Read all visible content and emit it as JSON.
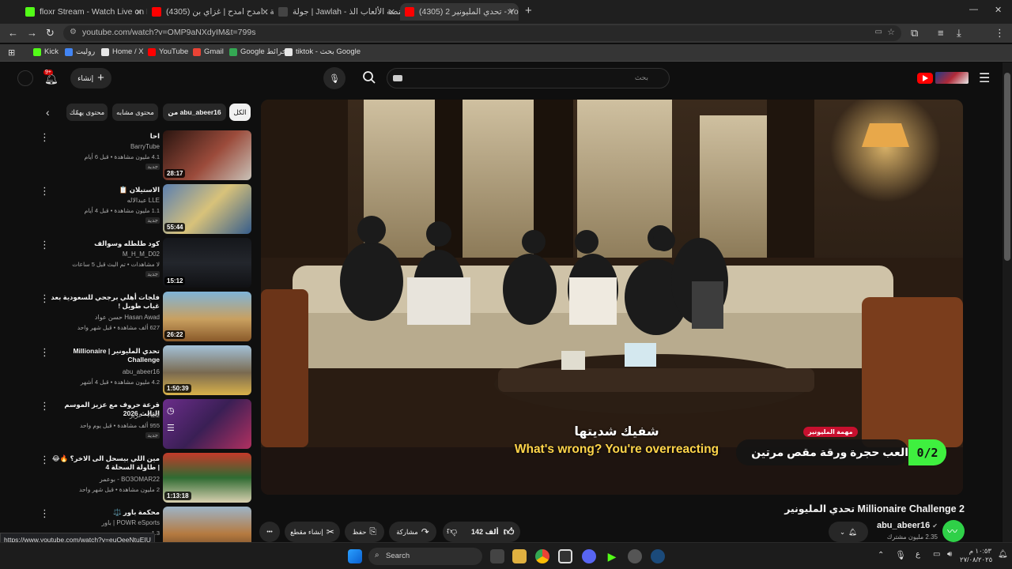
{
  "browser": {
    "tabs": [
      {
        "label": "floxr Stream - Watch Live on Kick",
        "color": "#53fc18",
        "active": false
      },
      {
        "label": "(4305) شيلة : امدح امدح | غزاي بن",
        "color": "#ff0000",
        "active": false
      },
      {
        "label": "جولة | Jawlah - منصة الألعاب الذ",
        "color": "#1f1f1f",
        "active": false
      },
      {
        "label": "(4305) تحدي المليونير 2 - YouTube",
        "color": "#ff0000",
        "active": true
      }
    ],
    "new_tab": "+",
    "url": "youtube.com/watch?v=OMP9aNXdyIM&t=799s",
    "bookmarks": [
      {
        "label": "Kick",
        "color": "#53fc18"
      },
      {
        "label": "روليت",
        "color": "#4285f4"
      },
      {
        "label": "Home / X",
        "color": "#e7e7e7"
      },
      {
        "label": "YouTube",
        "color": "#ff0000"
      },
      {
        "label": "Gmail",
        "color": "#ea4335"
      },
      {
        "label": "Google خرائط",
        "color": "#34a853"
      },
      {
        "label": "tiktok - بحث Google",
        "color": "#e7e7e7"
      }
    ]
  },
  "header": {
    "create_label": "إنشاء",
    "notif_count": "9+",
    "search_placeholder": "بحث"
  },
  "chips": [
    {
      "label": "الكل",
      "selected": true
    },
    {
      "label": "من abu_abeer16",
      "selected": false
    },
    {
      "label": "محتوى مشابه",
      "selected": false
    },
    {
      "label": "محتوى يهمّك",
      "selected": false
    }
  ],
  "recommendations": [
    {
      "title": "احا",
      "channel": "BarryTube",
      "meta": "4.1 مليون مشاهدة • قبل 6 أيام",
      "badge": "جديد",
      "duration": "28:17",
      "thumb": "#8a4a3a"
    },
    {
      "title": "الاستيلان 📋",
      "channel": "عبدالاله LLE",
      "meta": "1.1 مليون مشاهدة • قبل 4 أيام",
      "badge": "جديد",
      "duration": "55:44",
      "thumb": "#6e8fb5"
    },
    {
      "title": "كود طلطله وسوالف",
      "channel": "M_H_M_D02",
      "meta": "لا مشاهدات • تم البث قبل 5 ساعات",
      "badge": "جديد",
      "duration": "15:12",
      "thumb": "#1d1f24"
    },
    {
      "title": "فلجات أهلي برجحي للسعودية بعد غياب طويل !",
      "channel": "حسن عواد Hasan Awad",
      "meta": "627 ألف مشاهدة • قبل شهر واحد",
      "badge": "",
      "duration": "26:22",
      "thumb": "#c9a060"
    },
    {
      "title": "تحدي المليونير | Millionaire Challenge",
      "channel": "abu_abeer16",
      "meta": "4.2 مليون مشاهدة • قبل 4 أشهر",
      "badge": "",
      "duration": "1:50:39",
      "thumb": "#a3c1d8"
    },
    {
      "title": "قرعة حروف مع عزيز الموسم الثالث 2026",
      "channel": "عزيز - Aziz",
      "meta": "955 ألف مشاهدة • قبل يوم واحد",
      "badge": "جديد",
      "duration": "",
      "thumb": "#4a2d6b"
    },
    {
      "title": "مين اللي بيسحل الى الاخر؟ 🔥😂 | طاولة السحلة 4",
      "channel": "بوعمر - BO3OMAR22",
      "meta": "2 مليون مشاهدة • قبل شهر واحد",
      "badge": "",
      "duration": "1:13:18",
      "thumb": "#2f6b32"
    },
    {
      "title": "محكمة باور ⚖️",
      "channel": "باور | POWR eSports",
      "meta": "1.3 م",
      "badge": "",
      "duration": "",
      "thumb": "#b57a40"
    }
  ],
  "player": {
    "subtitle_ar": "شفيك شديتها",
    "subtitle_en": "What's wrong? You're overreacting",
    "overlay_tag": "مهمة المليونير",
    "overlay_task": "العب حجرة ورقة مقص مرتين",
    "overlay_counter": "0/2"
  },
  "video": {
    "title": "تحدي المليونير Millionaire Challenge 2",
    "channel": "abu_abeer16",
    "subs": "2.35 مليون مشترك",
    "likes": "142 ألف",
    "share": "مشاركة",
    "save": "حفظ",
    "clip": "إنشاء مقطع",
    "more": "•••"
  },
  "status_url": "https://www.youtube.com/watch?v=euQeeNtuEIU",
  "taskbar": {
    "search": "Search",
    "lang": "ع",
    "time": "١٠:٥٣ م",
    "date": "٢٧/٠٨/٢٠٢٥"
  }
}
